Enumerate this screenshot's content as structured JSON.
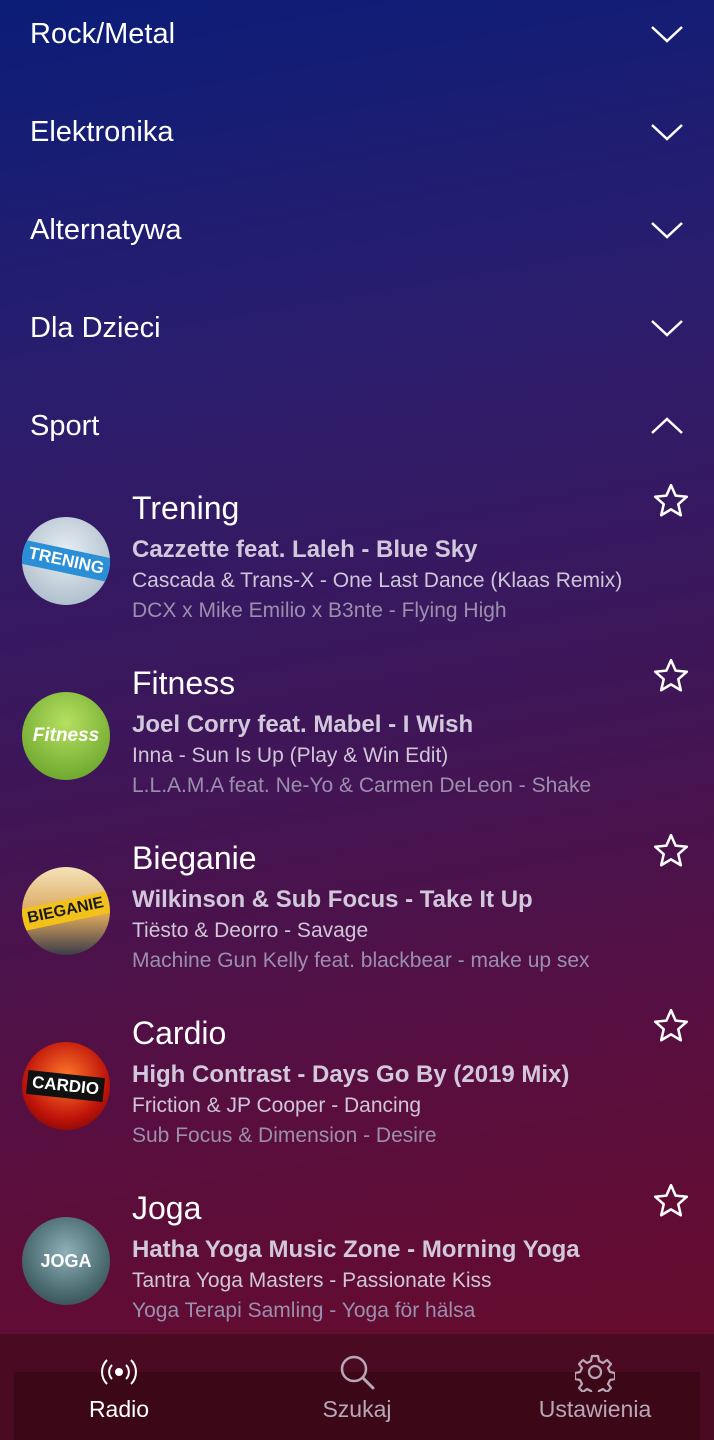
{
  "categories": [
    {
      "label": "Rock/Metal",
      "expanded": false
    },
    {
      "label": "Elektronika",
      "expanded": false
    },
    {
      "label": "Alternatywa",
      "expanded": false
    },
    {
      "label": "Dla Dzieci",
      "expanded": false
    },
    {
      "label": "Sport",
      "expanded": true
    }
  ],
  "stations": [
    {
      "name": "Trening",
      "logo_text": "TRENING",
      "line1": "Cazzette feat. Laleh - Blue Sky",
      "line2": "Cascada & Trans-X - One Last Dance (Klaas Remix)",
      "line3": "DCX x Mike Emilio x B3nte - Flying High"
    },
    {
      "name": "Fitness",
      "logo_text": "Fitness",
      "line1": "Joel Corry feat. Mabel - I Wish",
      "line2": "Inna - Sun Is Up (Play & Win Edit)",
      "line3": "L.L.A.M.A feat. Ne-Yo & Carmen DeLeon - Shake"
    },
    {
      "name": "Bieganie",
      "logo_text": "BIEGANIE",
      "line1": "Wilkinson & Sub Focus - Take It Up",
      "line2": "Tiësto & Deorro - Savage",
      "line3": "Machine Gun Kelly feat. blackbear - make up sex"
    },
    {
      "name": "Cardio",
      "logo_text": "CARDIO",
      "line1": "High Contrast - Days Go By (2019 Mix)",
      "line2": "Friction & JP Cooper - Dancing",
      "line3": "Sub Focus & Dimension - Desire"
    },
    {
      "name": "Joga",
      "logo_text": "JOGA",
      "line1": "Hatha Yoga Music Zone - Morning Yoga",
      "line2": "Tantra Yoga Masters - Passionate Kiss",
      "line3": "Yoga Terapi Samling - Yoga för hälsa"
    }
  ],
  "nav": [
    {
      "label": "Radio",
      "icon": "radio-broadcast-icon",
      "active": true
    },
    {
      "label": "Szukaj",
      "icon": "search-icon",
      "active": false
    },
    {
      "label": "Ustawienia",
      "icon": "gear-icon",
      "active": false
    }
  ],
  "colors": {
    "text_primary": "#ffffff",
    "text_secondary": "#cfc6d8",
    "text_muted": "#9c8fae",
    "nav_background": "#4a0a22"
  }
}
